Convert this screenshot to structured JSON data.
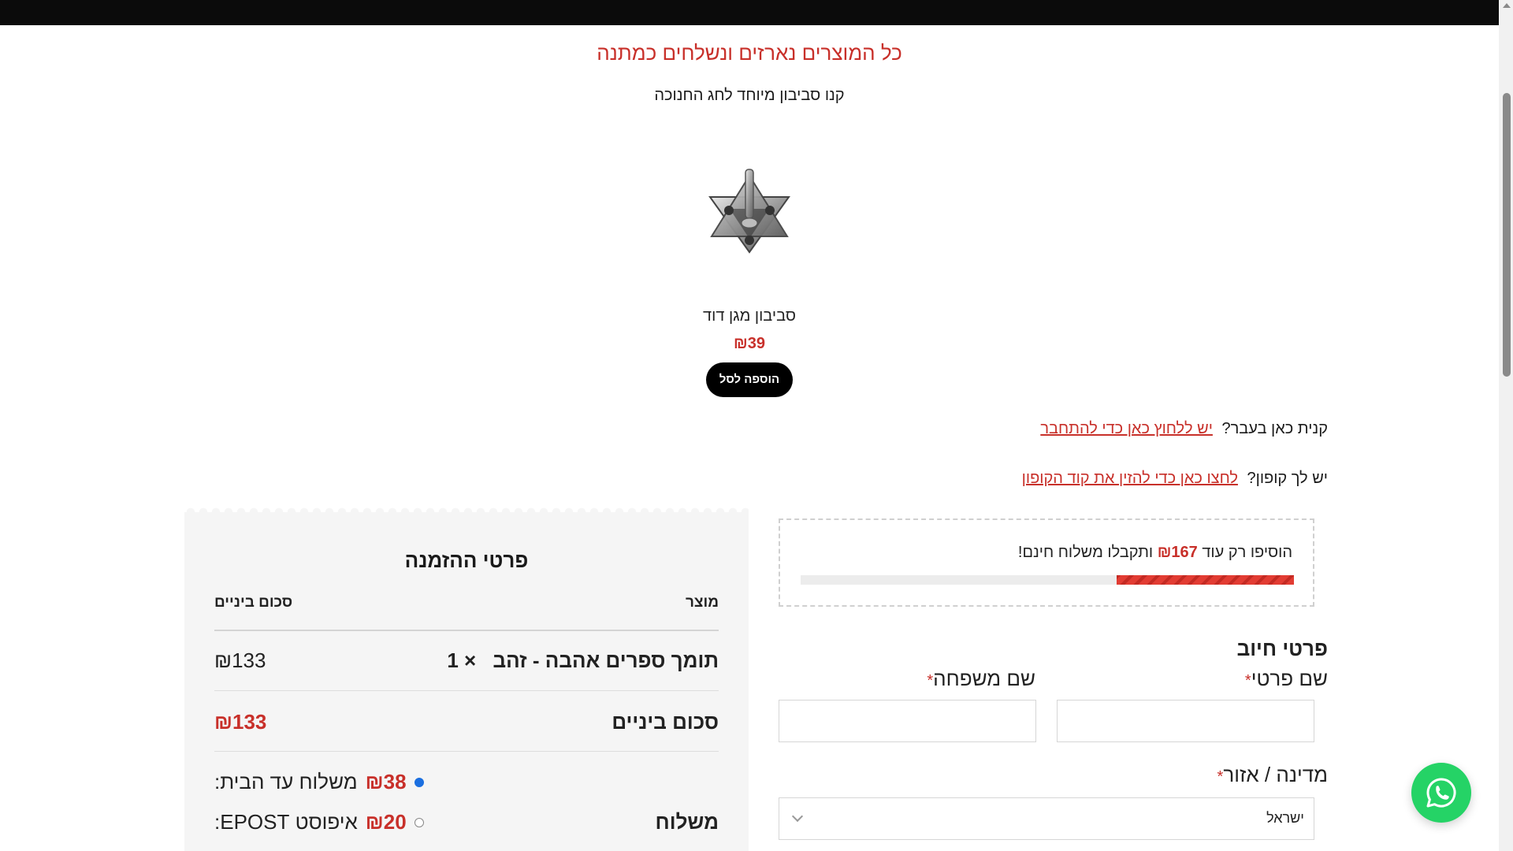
{
  "promo": {
    "title": "כל המוצרים נארזים ונשלחים כמתנה",
    "subtitle": "קנו סביבון מיוחד לחג החנוכה"
  },
  "upsell_product": {
    "name": "סביבון מגן דוד",
    "price": "₪39",
    "add_to_cart_label": "הוספה לסל",
    "image_icon": "silver-star-of-david-dreidel-image"
  },
  "notices": {
    "returning_customer_text": "קנית כאן בעבר?",
    "returning_customer_link": "יש ללחוץ כאן כדי להתחבר",
    "coupon_text": "יש לך קופון?",
    "coupon_link": "לחצו כאן כדי להזין את קוד הקופון"
  },
  "free_shipping": {
    "text_before": "הוסיפו רק עוד",
    "amount": "₪167",
    "text_after": "ותקבלו משלוח חינם!",
    "progress_fraction": 0.36
  },
  "order": {
    "title": "פרטי ההזמנה",
    "col_product": "מוצר",
    "col_subtotal": "סכום ביניים",
    "item_name": "תומך ספרים אהבה - זהב",
    "item_qty": "× 1",
    "item_total": "₪133",
    "subtotal_label": "סכום ביניים",
    "subtotal_value": "₪133",
    "shipping_label": "משלוח",
    "shipping_options": [
      {
        "label": "משלוח עד הבית:",
        "amount": "₪38",
        "selected": true
      },
      {
        "label": "איפוסט EPOST:",
        "amount": "₪20",
        "selected": false
      }
    ]
  },
  "billing": {
    "title": "פרטי חיוב",
    "first_name_label": "שם פרטי",
    "last_name_label": "שם משפחה",
    "required_mark": "*",
    "country_label": "מדינה / אזור",
    "country_value": "ישראל"
  },
  "whatsapp": {
    "icon": "whatsapp-icon"
  },
  "colors": {
    "accent": "#c8302a",
    "whatsapp": "#25d366",
    "panel_bg": "#f5f5f5"
  }
}
